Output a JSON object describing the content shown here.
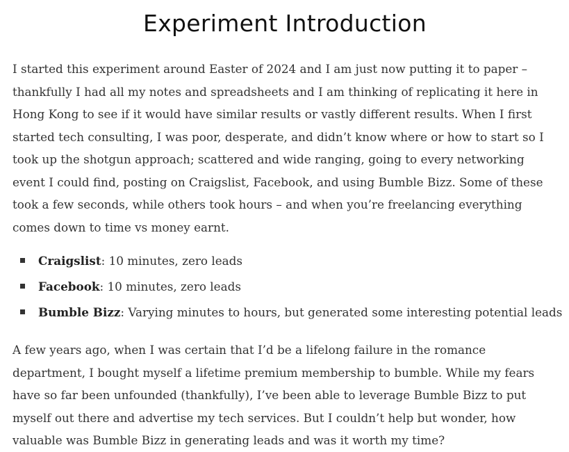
{
  "article": {
    "title": "Experiment Introduction",
    "intro_paragraph": "I started this experiment around Easter of 2024 and I am just now putting it to paper – thankfully I had all my notes and spreadsheets and I am thinking of replicating it here in Hong Kong to see if it would have similar results or vastly different results. When I first started tech consulting, I was poor, desperate, and didn’t know where or how to start so I took up the shotgun approach; scattered and wide ranging, going to every networking event I could find, posting on Craigslist, Facebook, and using Bumble Bizz. Some of these took a few seconds, while others took hours – and when you’re freelancing everything comes down to time vs money earnt.",
    "channels": [
      {
        "name": "Craigslist",
        "detail": ": 10 minutes, zero leads"
      },
      {
        "name": "Facebook",
        "detail": ": 10 minutes, zero leads"
      },
      {
        "name": "Bumble Bizz",
        "detail": ": Varying minutes to hours, but generated some interesting potential leads"
      }
    ],
    "closing_paragraph": "A few years ago, when I was certain that I’d be a lifelong failure in the romance department, I bought myself a lifetime premium membership to bumble. While my fears have so far been unfounded (thankfully), I’ve been able to leverage Bumble Bizz to put myself out there and advertise my tech services. But I couldn’t help but wonder, how valuable was Bumble Bizz in generating leads and was it worth my time?"
  }
}
